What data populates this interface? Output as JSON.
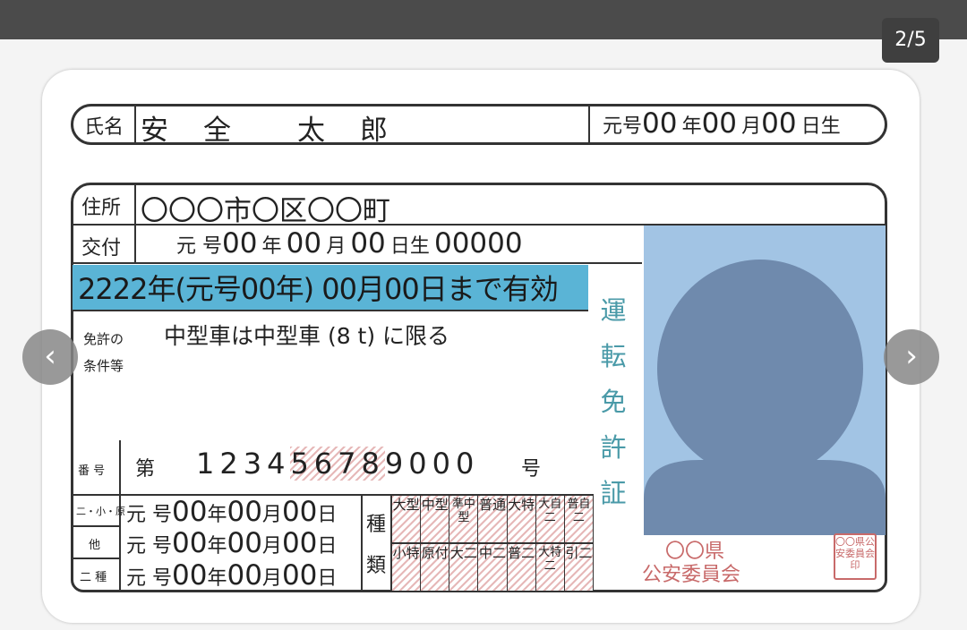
{
  "viewer": {
    "counter": "2/5",
    "prev_icon": "‹",
    "next_icon": "›"
  },
  "license": {
    "name_label": "氏名",
    "name_value": "安　全　　太　郎",
    "birth_era": "元号",
    "birth_year": "00",
    "birth_year_unit": "年",
    "birth_month": "00",
    "birth_month_unit": "月",
    "birth_day": "00",
    "birth_day_unit": "日生",
    "address_label": "住所",
    "address_value": "〇〇〇市〇区〇〇町",
    "issue_label": "交付",
    "issue_era": "元 号",
    "issue_year": "00",
    "issue_year_unit": "年",
    "issue_month": "00",
    "issue_month_unit": "月",
    "issue_day": "00",
    "issue_day_unit": "日生",
    "issue_number": "00000",
    "valid_until": "2222年(元号00年) 00月00日まで有効",
    "conditions_label_1": "免許の",
    "conditions_label_2": "条件等",
    "conditions_value": "中型車は中型車 (8 t) に限る",
    "title_chars": [
      "運",
      "転",
      "免",
      "許",
      "証"
    ],
    "number_label": "番 号",
    "number_prefix": "第",
    "number_part1": "1234",
    "number_part2": "5678",
    "number_part3": "9000",
    "number_suffix": "号",
    "date_rows": [
      {
        "label": "二・小・原",
        "era": "元 号",
        "y": "00",
        "yu": "年",
        "m": "00",
        "mu": "月",
        "d": "00",
        "du": "日"
      },
      {
        "label": "他",
        "era": "元 号",
        "y": "00",
        "yu": "年",
        "m": "00",
        "mu": "月",
        "d": "00",
        "du": "日"
      },
      {
        "label": "二 種",
        "era": "元 号",
        "y": "00",
        "yu": "年",
        "m": "00",
        "mu": "月",
        "d": "00",
        "du": "日"
      }
    ],
    "types_label_1": "種",
    "types_label_2": "類",
    "types_top": [
      "大型",
      "中型",
      "準中型",
      "普通",
      "大特",
      "大自二",
      "普自二"
    ],
    "types_bottom": [
      "小特",
      "原付",
      "大二",
      "中二",
      "普二",
      "大特二",
      "引二"
    ],
    "issuer_1": "〇〇県",
    "issuer_2": "公安委員会",
    "seal": "〇〇県公安委員会印"
  },
  "colors": {
    "valid_band": "#5ab4d6",
    "photo_bg": "#a2c4e4",
    "silhouette": "#6f8aad",
    "title": "#4a9aa8",
    "issuer": "#c86a6a"
  }
}
